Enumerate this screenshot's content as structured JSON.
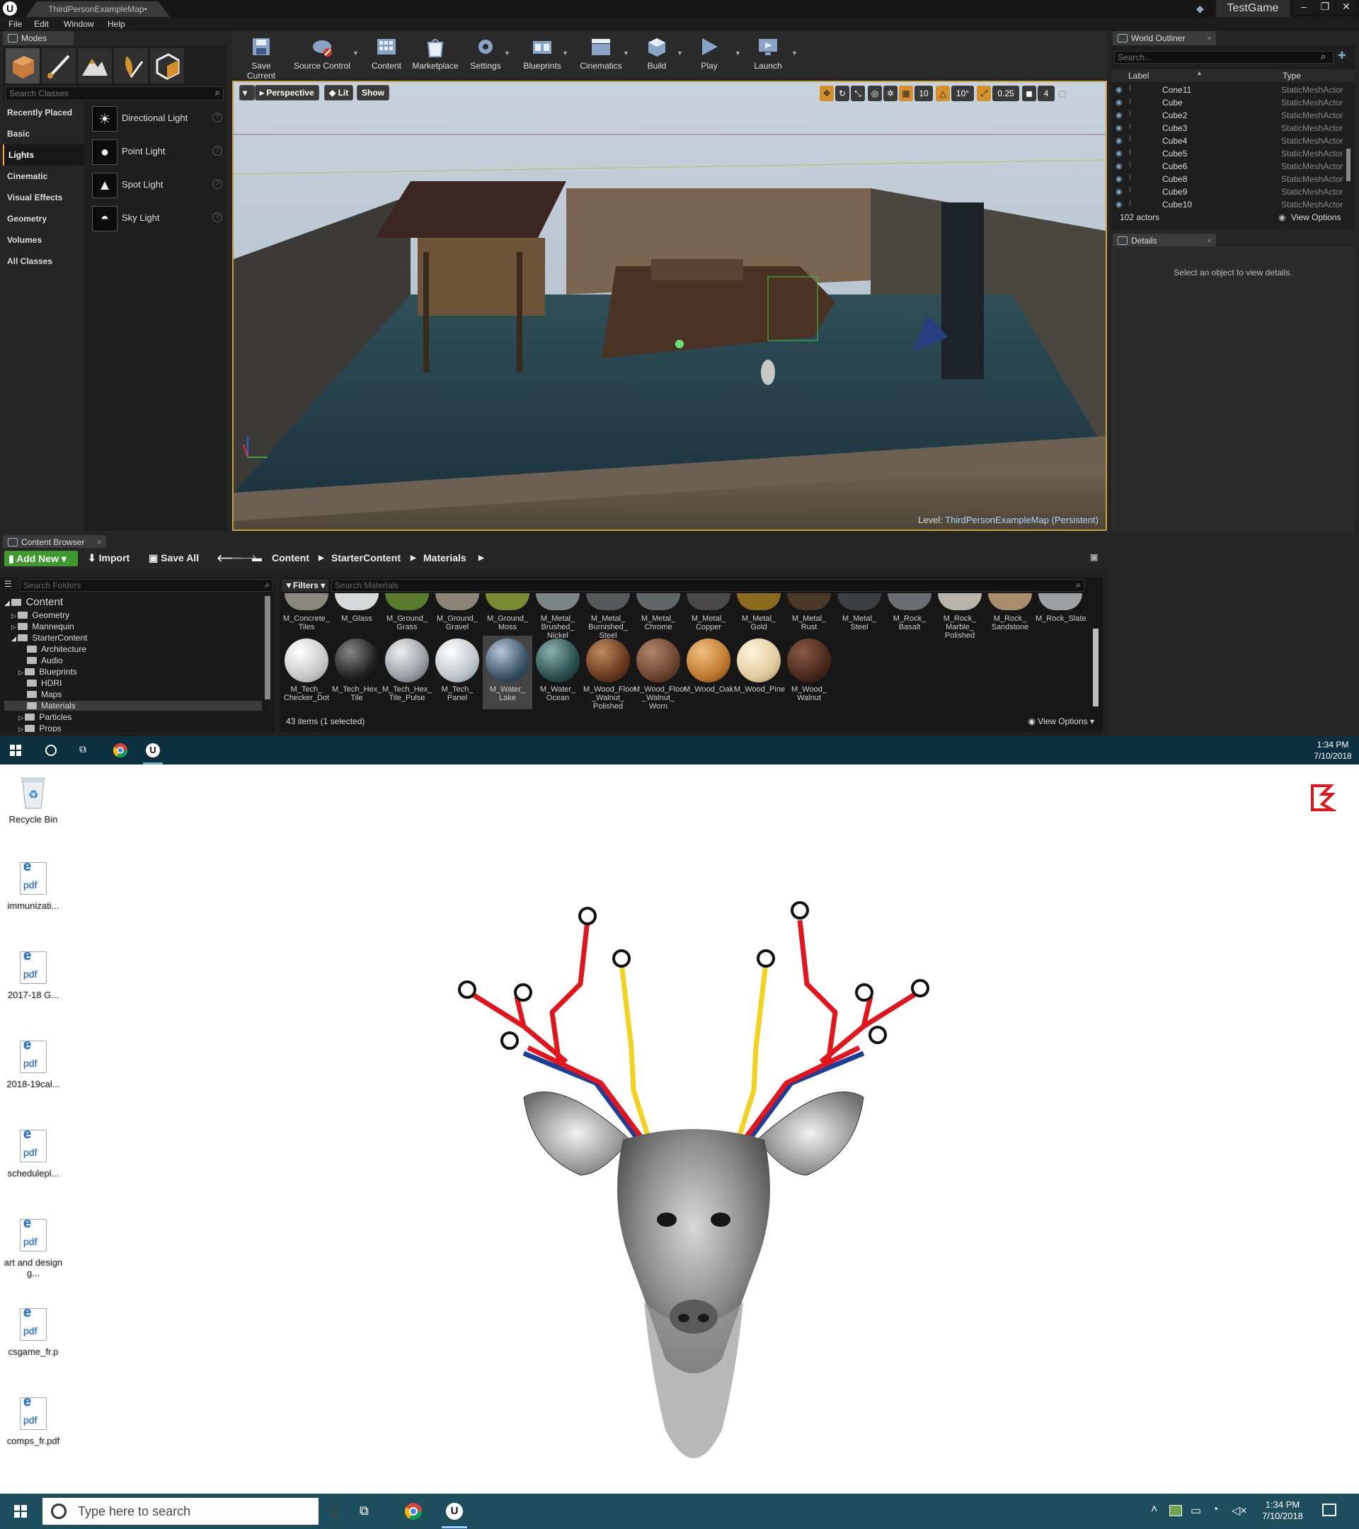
{
  "window": {
    "doc_tab": "ThirdPersonExampleMap•",
    "project": "TestGame",
    "logo": "U"
  },
  "menu": [
    "File",
    "Edit",
    "Window",
    "Help"
  ],
  "modes": {
    "tab": "Modes",
    "search_placeholder": "Search Classes",
    "categories": [
      "Recently Placed",
      "Basic",
      "Lights",
      "Cinematic",
      "Visual Effects",
      "Geometry",
      "Volumes",
      "All Classes"
    ],
    "active_category": "Lights",
    "items": [
      "Directional Light",
      "Point Light",
      "Spot Light",
      "Sky Light"
    ]
  },
  "toolbar": [
    "Save Current",
    "Source Control",
    "Content",
    "Marketplace",
    "Settings",
    "Blueprints",
    "Cinematics",
    "Build",
    "Play",
    "Launch"
  ],
  "viewport": {
    "perspective": "Perspective",
    "lit": "Lit",
    "show": "Show",
    "grid_snap": "10",
    "rot_snap": "10°",
    "scale_snap": "0.25",
    "cam_speed": "4",
    "level_prefix": "Level:",
    "level_name": "ThirdPersonExampleMap (Persistent)"
  },
  "outliner": {
    "tab": "World Outliner",
    "search_placeholder": "Search...",
    "col_label": "Label",
    "col_type": "Type",
    "rows": [
      {
        "name": "Cone11",
        "type": "StaticMeshActor"
      },
      {
        "name": "Cube",
        "type": "StaticMeshActor"
      },
      {
        "name": "Cube2",
        "type": "StaticMeshActor"
      },
      {
        "name": "Cube3",
        "type": "StaticMeshActor"
      },
      {
        "name": "Cube4",
        "type": "StaticMeshActor"
      },
      {
        "name": "Cube5",
        "type": "StaticMeshActor"
      },
      {
        "name": "Cube6",
        "type": "StaticMeshActor"
      },
      {
        "name": "Cube8",
        "type": "StaticMeshActor"
      },
      {
        "name": "Cube9",
        "type": "StaticMeshActor"
      },
      {
        "name": "Cube10",
        "type": "StaticMeshActor"
      }
    ],
    "count": "102 actors",
    "view_options": "View Options"
  },
  "details": {
    "tab": "Details",
    "message": "Select an object to view details."
  },
  "content_browser": {
    "tab": "Content Browser",
    "add_new": "Add New",
    "import": "Import",
    "save_all": "Save All",
    "path": [
      "Content",
      "StarterContent",
      "Materials"
    ],
    "folder_search": "Search Folders",
    "folders": [
      "Content",
      "Geometry",
      "Mannequin",
      "StarterContent",
      "Architecture",
      "Audio",
      "Blueprints",
      "HDRI",
      "Maps",
      "Materials",
      "Particles",
      "Props"
    ],
    "filters": "Filters",
    "material_search": "Search Materials",
    "row1": [
      "M_Concrete_ Tiles",
      "M_Glass",
      "M_Ground_ Grass",
      "M_Ground_ Gravel",
      "M_Ground_ Moss",
      "M_Metal_ Brushed_ Nickel",
      "M_Metal_ Burnished_ Steel",
      "M_Metal_ Chrome",
      "M_Metal_ Copper",
      "M_Metal_ Gold",
      "M_Metal_ Rust",
      "M_Metal_ Steel",
      "M_Rock_ Basalt",
      "M_Rock_ Marble_ Polished",
      "M_Rock_ Sandstone",
      "M_Rock_Slate"
    ],
    "row2": [
      "M_Tech_ Checker_Dot",
      "M_Tech_Hex_ Tile",
      "M_Tech_Hex_ Tile_Pulse",
      "M_Tech_ Panel",
      "M_Water_ Lake",
      "M_Water_ Ocean",
      "M_Wood_Floor _Walnut_ Polished",
      "M_Wood_Floor _Walnut_ Worn",
      "M_Wood_Oak",
      "M_Wood_Pine",
      "M_Wood_ Walnut"
    ],
    "status": "43 items (1 selected)",
    "view_options": "View Options"
  },
  "taskbar_top": {
    "time": "1:34 PM",
    "date": "7/10/2018"
  },
  "desktop": {
    "icons": [
      "Recycle Bin",
      "immunizati...",
      "2017-18 G...",
      "2018-19cal...",
      "schedulepl...",
      "art and design g...",
      "csgame_fr.p",
      "comps_fr.pdf"
    ],
    "pdf_e": "e",
    "pdf_label": "pdf"
  },
  "taskbar_bottom": {
    "search": "Type here to search",
    "time": "1:34 PM",
    "date": "7/10/2018"
  },
  "colors": {
    "accent_orange": "#d4902a",
    "add_green": "#3f9a2e",
    "antler_red": "#e3141b",
    "antler_yellow": "#f2d21b",
    "antler_blue": "#1b3e9b"
  }
}
